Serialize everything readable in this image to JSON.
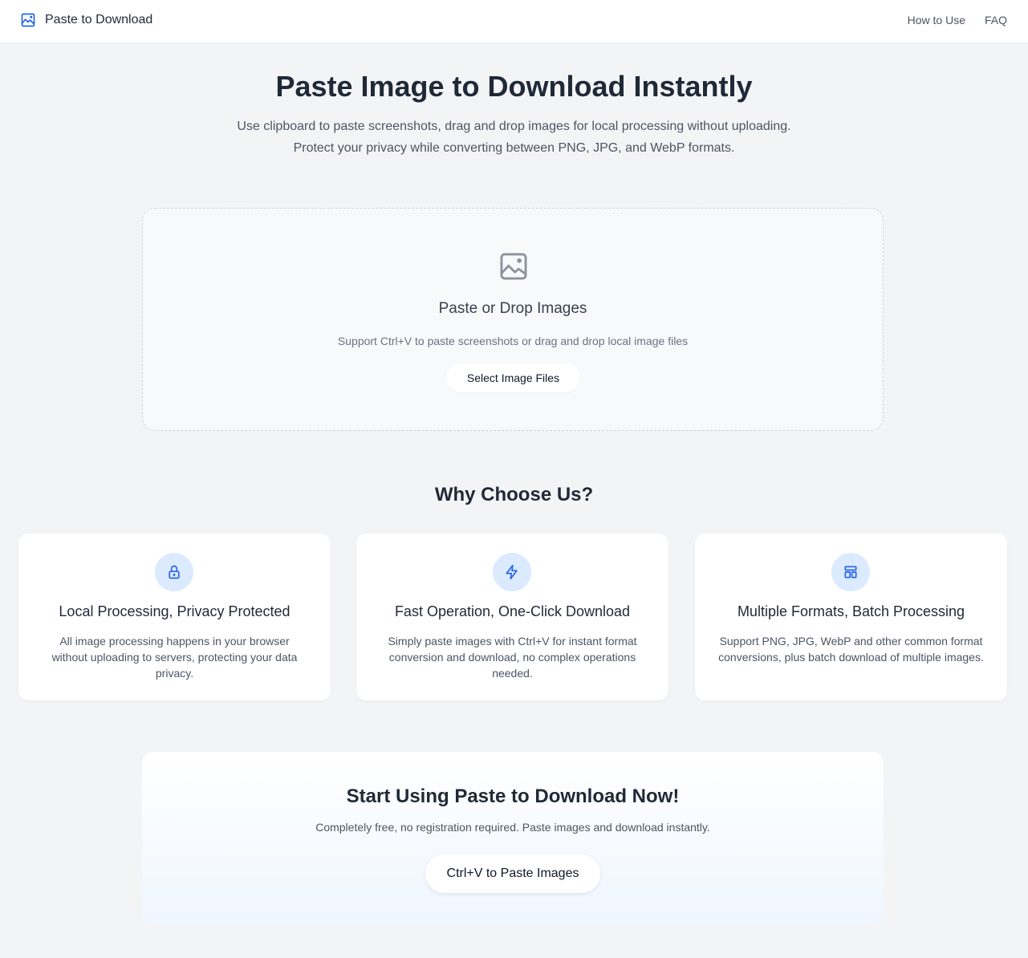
{
  "header": {
    "brand": "Paste to Download",
    "nav": [
      "How to Use",
      "FAQ"
    ]
  },
  "hero": {
    "title": "Paste Image to Download Instantly",
    "subtitle_line1": "Use clipboard to paste screenshots, drag and drop images for local processing without uploading.",
    "subtitle_line2": "Protect your privacy while converting between PNG, JPG, and WebP formats."
  },
  "dropzone": {
    "title": "Paste or Drop Images",
    "hint": "Support Ctrl+V to paste screenshots or drag and drop local image files",
    "button": "Select Image Files"
  },
  "why": {
    "title": "Why Choose Us?",
    "cards": [
      {
        "icon": "lock-icon",
        "title": "Local Processing, Privacy Protected",
        "desc": "All image processing happens in your browser without uploading to servers, protecting your data privacy."
      },
      {
        "icon": "lightning-icon",
        "title": "Fast Operation, One-Click Download",
        "desc": "Simply paste images with Ctrl+V for instant format conversion and download, no complex operations needed."
      },
      {
        "icon": "layout-icon",
        "title": "Multiple Formats, Batch Processing",
        "desc": "Support PNG, JPG, WebP and other common format conversions, plus batch download of multiple images."
      }
    ]
  },
  "cta": {
    "title": "Start Using Paste to Download Now!",
    "subtitle": "Completely free, no registration required. Paste images and download instantly.",
    "button": "Ctrl+V to Paste Images"
  },
  "colors": {
    "accent": "#2563eb",
    "icon_bg": "#dbeafe",
    "page_bg": "#f3f4f6"
  }
}
